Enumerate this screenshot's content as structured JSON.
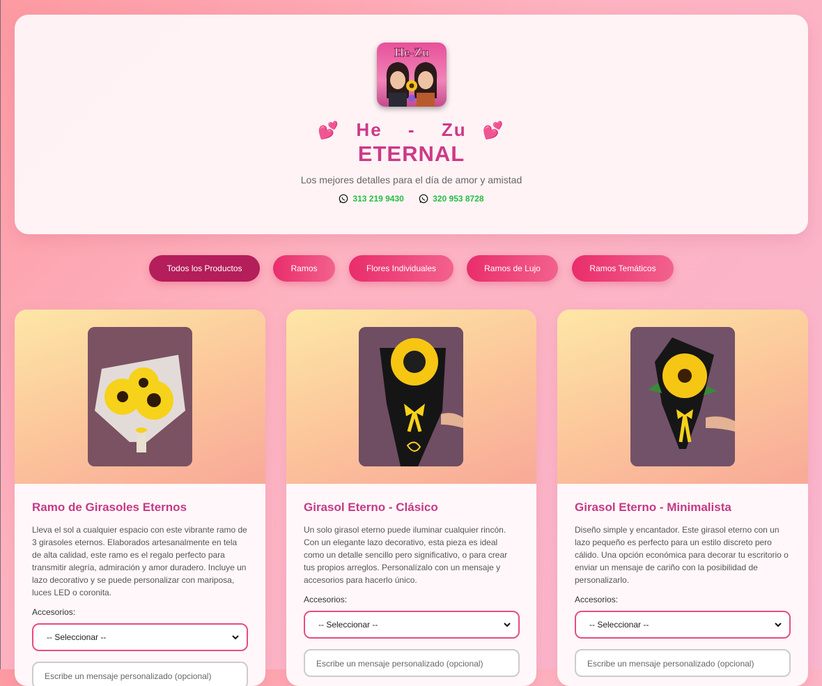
{
  "header": {
    "logo_text": "He-Zu",
    "brand_he": "He",
    "brand_dash": "-",
    "brand_zu": "Zu",
    "brand_sub": "ETERNAL",
    "tagline": "Los mejores detalles para el día de amor y amistad",
    "phones": [
      "313 219 9430",
      "320 953 8728"
    ]
  },
  "tabs": [
    {
      "label": "Todos los Productos",
      "active": true
    },
    {
      "label": "Ramos",
      "active": false
    },
    {
      "label": "Flores Individuales",
      "active": false
    },
    {
      "label": "Ramos de Lujo",
      "active": false
    },
    {
      "label": "Ramos Temáticos",
      "active": false
    }
  ],
  "products": [
    {
      "title": "Ramo de Girasoles Eternos",
      "description": "Lleva el sol a cualquier espacio con este vibrante ramo de 3 girasoles eternos. Elaborados artesanalmente en tela de alta calidad, este ramo es el regalo perfecto para transmitir alegría, admiración y amor duradero. Incluye un lazo decorativo y se puede personalizar con mariposa, luces LED o coronita.",
      "accessories_label": "Accesorios:",
      "select_value": "-- Seleccionar --",
      "message_placeholder": "Escribe un mensaje personalizado (opcional)"
    },
    {
      "title": "Girasol Eterno - Clásico",
      "description": "Un solo girasol eterno puede iluminar cualquier rincón. Con un elegante lazo decorativo, esta pieza es ideal como un detalle sencillo pero significativo, o para crear tus propios arreglos. Personalízalo con un mensaje y accesorios para hacerlo único.",
      "accessories_label": "Accesorios:",
      "select_value": "-- Seleccionar --",
      "message_placeholder": "Escribe un mensaje personalizado (opcional)"
    },
    {
      "title": "Girasol Eterno - Minimalista",
      "description": "Diseño simple y encantador. Este girasol eterno con un lazo pequeño es perfecto para un estilo discreto pero cálido. Una opción económica para decorar tu escritorio o enviar un mensaje de cariño con la posibilidad de personalizarlo.",
      "accessories_label": "Accesorios:",
      "select_value": "-- Seleccionar --",
      "message_placeholder": "Escribe un mensaje personalizado (opcional)"
    }
  ],
  "colors": {
    "brand": "#cc3a87",
    "tab_active": "#b41e5a",
    "tab": "#e92d6c",
    "whatsapp": "#26c043"
  },
  "icons": [
    "whatsapp-icon",
    "heart-icon",
    "chevron-down-icon"
  ]
}
